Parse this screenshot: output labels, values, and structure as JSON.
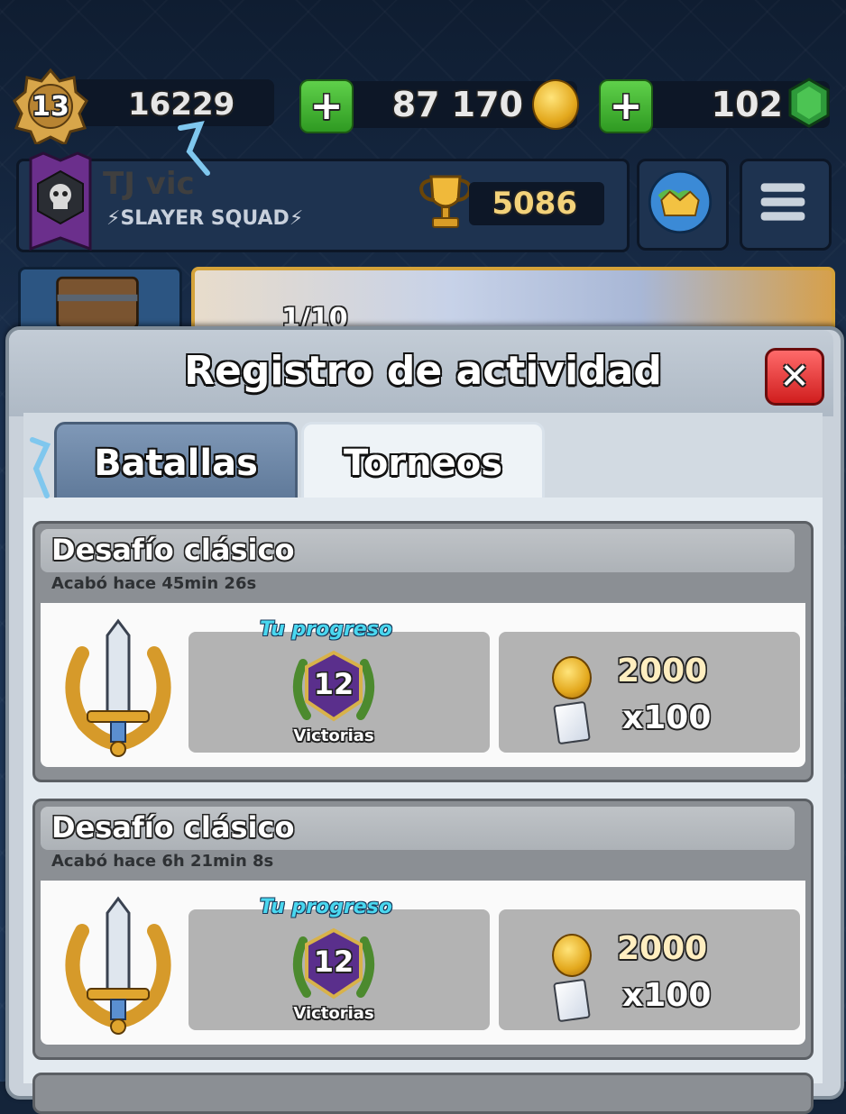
{
  "top_bar": {
    "level": "13",
    "experience": "16229",
    "gold": "87 170",
    "gems": "102",
    "plus_symbol": "+"
  },
  "profile": {
    "player_name": "TJ vic",
    "clan_name": "⚡SLAYER SQUAD⚡",
    "trophies": "5086"
  },
  "banner": {
    "progress_text": "1/10"
  },
  "modal": {
    "title": "Registro de actividad",
    "close_symbol": "✕",
    "tabs": [
      {
        "label": "Batallas",
        "active": false
      },
      {
        "label": "Torneos",
        "active": true
      }
    ]
  },
  "entries": [
    {
      "title": "Desafío clásico",
      "ended": "Acabó hace 45min  26s",
      "progress_label": "Tu progreso",
      "wins": "12",
      "wins_label": "Victorias",
      "reward_gold": "2000",
      "reward_cards": "x100"
    },
    {
      "title": "Desafío clásico",
      "ended": "Acabó hace 6h 21min  8s",
      "progress_label": "Tu progreso",
      "wins": "12",
      "wins_label": "Victorias",
      "reward_gold": "2000",
      "reward_cards": "x100"
    }
  ],
  "icons": [
    "level-badge-icon",
    "gold-coin-icon",
    "gem-icon",
    "clan-skull-badge-icon",
    "trophy-icon",
    "globe-crown-icon",
    "menu-icon",
    "chest-icon",
    "sword-laurel-emblem-icon",
    "laurel-badge-icon",
    "card-icon"
  ],
  "colors": {
    "gem_green": "#2e9a3a",
    "coin_gold": "#e3a81d",
    "close_red": "#d01e1e",
    "progress_cyan": "#4ad8f0",
    "plus_green": "#3fb52e"
  }
}
